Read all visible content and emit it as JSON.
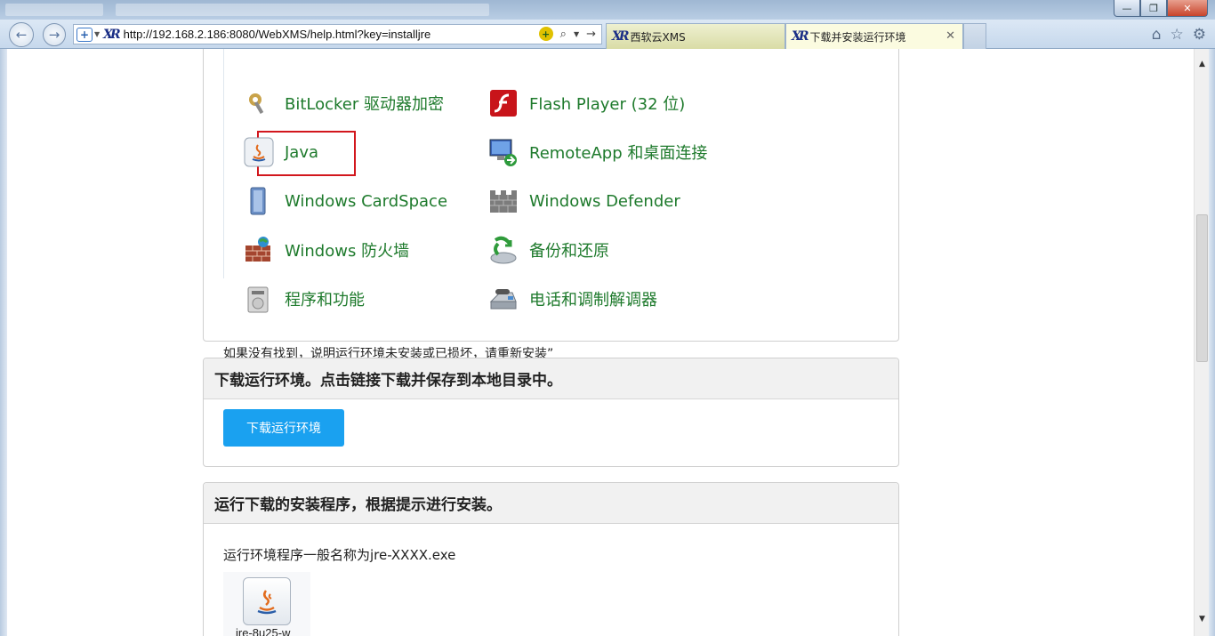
{
  "browser": {
    "address_url": "http://192.168.2.186:8080/WebXMS/help.html?key=installjre",
    "tabs": [
      {
        "label": "西软云XMS"
      },
      {
        "label": "下载并安装运行环境"
      }
    ],
    "window_buttons": {
      "minimize": "—",
      "restore": "❐",
      "close": "✕"
    }
  },
  "control_panel": {
    "items": [
      {
        "label": "BitLocker 驱动器加密",
        "icon": "bitlocker-icon"
      },
      {
        "label": "Flash Player (32 位)",
        "icon": "flash-player-icon"
      },
      {
        "label": "Java",
        "icon": "java-icon"
      },
      {
        "label": "RemoteApp 和桌面连接",
        "icon": "remoteapp-icon"
      },
      {
        "label": "Windows CardSpace",
        "icon": "cardspace-icon"
      },
      {
        "label": "Windows Defender",
        "icon": "defender-icon"
      },
      {
        "label": "Windows 防火墙",
        "icon": "firewall-icon"
      },
      {
        "label": "备份和还原",
        "icon": "backup-icon"
      },
      {
        "label": "程序和功能",
        "icon": "programs-icon"
      },
      {
        "label": "电话和调制解调器",
        "icon": "phone-modem-icon"
      }
    ],
    "note": "如果没有找到，说明运行环境未安装或已损坏，请重新安装”"
  },
  "step2": {
    "heading": "下载运行环境。点击链接下载并保存到本地目录中。",
    "button": "下载运行环境"
  },
  "step3": {
    "heading": "运行下载的安装程序，根据提示进行安装。",
    "text": "运行环境程序一般名称为jre-XXXX.exe",
    "file_name": "jre-8u25-w"
  },
  "colors": {
    "accent": "#1aa1f0",
    "link_green": "#1e7a2c",
    "highlight": "#d2171d"
  }
}
